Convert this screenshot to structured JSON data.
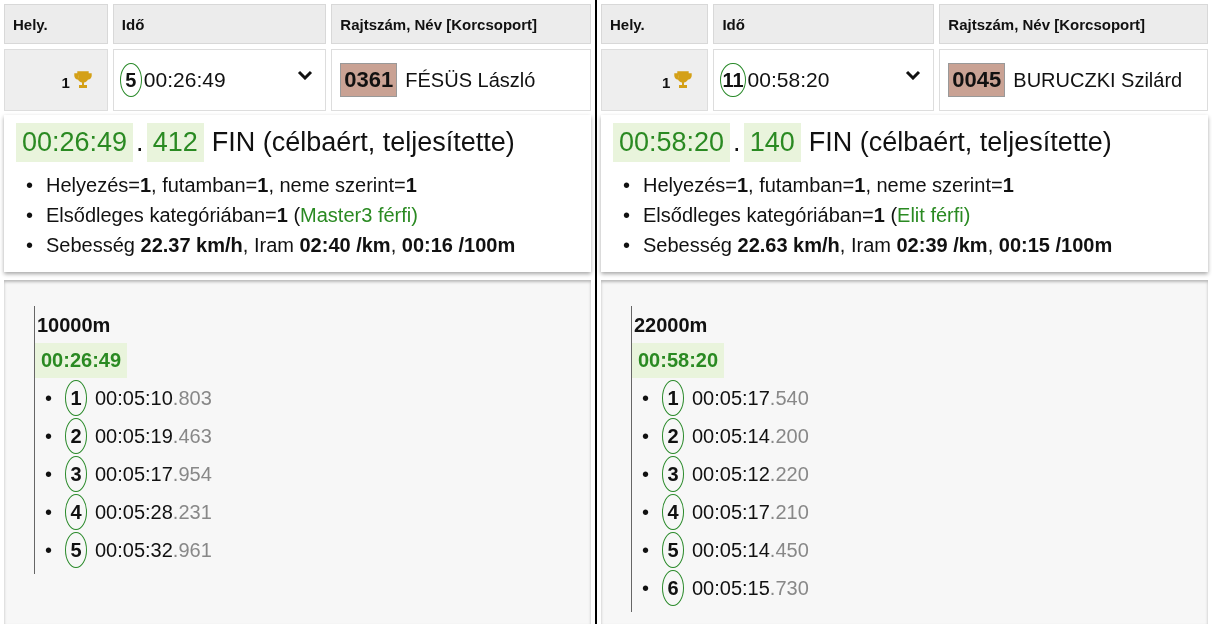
{
  "panels": [
    {
      "columns": [
        "Hely.",
        "Idő",
        "Rajtszám, Név [Korcsoport]"
      ],
      "row": {
        "place": "1",
        "laps": "5",
        "time": "00:26:49",
        "bib": "0361",
        "name": "FÉSÜS László"
      },
      "result": {
        "time": "00:26:49",
        "separator": ".",
        "fraction": "412",
        "status": "FIN (célbaért, teljesítette)",
        "details": [
          {
            "kind": "plain",
            "bullet": "•",
            "text": "Helyezés=**1**, futamban=**1**, neme szerint=**1**"
          },
          {
            "kind": "category",
            "bullet": "•",
            "text": "Elsődleges kategóriában=**1** (",
            "category": "Master3 férfi)"
          },
          {
            "kind": "plain",
            "bullet": "•",
            "text": "Sebesség **22.37 km/h**, Iram **02:40 /km**, **00:16 /100m**"
          }
        ]
      },
      "splits": {
        "distance": "10000m",
        "total": "00:26:49",
        "laps": [
          {
            "bullet": "•",
            "lap": "1",
            "time": "00:05:10",
            "fraction": ".803"
          },
          {
            "bullet": "•",
            "lap": "2",
            "time": "00:05:19",
            "fraction": ".463"
          },
          {
            "bullet": "•",
            "lap": "3",
            "time": "00:05:17",
            "fraction": ".954"
          },
          {
            "bullet": "•",
            "lap": "4",
            "time": "00:05:28",
            "fraction": ".231"
          },
          {
            "bullet": "•",
            "lap": "5",
            "time": "00:05:32",
            "fraction": ".961"
          }
        ]
      }
    },
    {
      "columns": [
        "Hely.",
        "Idő",
        "Rajtszám, Név [Korcsoport]"
      ],
      "row": {
        "place": "1",
        "laps": "11",
        "time": "00:58:20",
        "bib": "0045",
        "name": "BURUCZKI Szilárd"
      },
      "result": {
        "time": "00:58:20",
        "separator": ".",
        "fraction": "140",
        "status": "FIN (célbaért, teljesítette)",
        "details": [
          {
            "kind": "plain",
            "bullet": "•",
            "text": "Helyezés=**1**, futamban=**1**, neme szerint=**1**"
          },
          {
            "kind": "category",
            "bullet": "•",
            "text": "Elsődleges kategóriában=**1** (",
            "category": "Elit férfi)"
          },
          {
            "kind": "plain",
            "bullet": "•",
            "text": "Sebesség **22.63 km/h**, Iram **02:39 /km**, **00:15 /100m**"
          }
        ]
      },
      "splits": {
        "distance": "22000m",
        "total": "00:58:20",
        "laps": [
          {
            "bullet": "•",
            "lap": "1",
            "time": "00:05:17",
            "fraction": ".540"
          },
          {
            "bullet": "•",
            "lap": "2",
            "time": "00:05:14",
            "fraction": ".200"
          },
          {
            "bullet": "•",
            "lap": "3",
            "time": "00:05:12",
            "fraction": ".220"
          },
          {
            "bullet": "•",
            "lap": "4",
            "time": "00:05:17",
            "fraction": ".210"
          },
          {
            "bullet": "•",
            "lap": "5",
            "time": "00:05:14",
            "fraction": ".450"
          },
          {
            "bullet": "•",
            "lap": "6",
            "time": "00:05:15",
            "fraction": ".730"
          }
        ]
      }
    }
  ]
}
